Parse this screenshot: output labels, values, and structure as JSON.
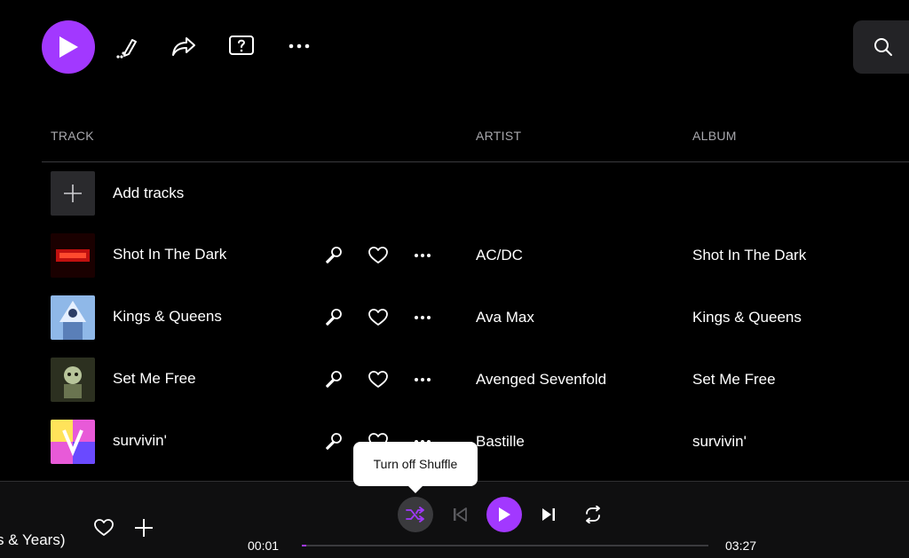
{
  "toolbar": {
    "icons": [
      "play-icon",
      "pencil-icon",
      "share-icon",
      "help-icon",
      "more-icon",
      "search-icon"
    ]
  },
  "columns": {
    "track": "TRACK",
    "artist": "ARTIST",
    "album": "ALBUM"
  },
  "add_tracks": {
    "label": "Add tracks"
  },
  "tracks": [
    {
      "title": "Shot In The Dark",
      "artist": "AC/DC",
      "album": "Shot In The Dark"
    },
    {
      "title": "Kings & Queens",
      "artist": "Ava Max",
      "album": "Kings & Queens"
    },
    {
      "title": "Set Me Free",
      "artist": "Avenged Sevenfold",
      "album": "Set Me Free"
    },
    {
      "title": "survivin'",
      "artist": "Bastille",
      "album": "survivin'"
    }
  ],
  "tooltip": {
    "text": "Turn off Shuffle"
  },
  "player": {
    "now_playing": "s & Years)",
    "elapsed": "00:01",
    "duration": "03:27",
    "progress": 0.005
  },
  "colors": {
    "accent": "#a238ff",
    "background": "#000000",
    "player_bg": "#0f0f10"
  }
}
